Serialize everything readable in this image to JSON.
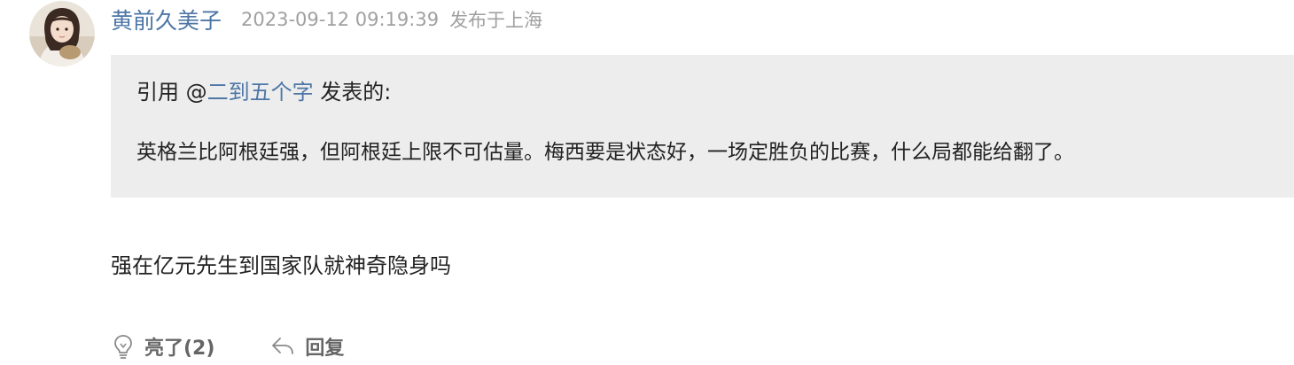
{
  "comment": {
    "author": "黄前久美子",
    "timestamp": "2023-09-12 09:19:39",
    "location": "发布于上海",
    "avatar_icon": "user-avatar-photo",
    "quote": {
      "prefix": "引用 @",
      "user": "二到五个字",
      "suffix": " 发表的:",
      "text": "英格兰比阿根廷强，但阿根廷上限不可估量。梅西要是状态好，一场定胜负的比赛，什么局都能给翻了。"
    },
    "text": "强在亿元先生到国家队就神奇隐身吗",
    "actions": {
      "like_label": "亮了(2)",
      "like_icon": "lightbulb-icon",
      "reply_label": "回复",
      "reply_icon": "reply-arrow-icon"
    }
  },
  "colors": {
    "link": "#4d76a6",
    "meta": "#a0a0a0",
    "quote_bg": "#ededed",
    "text": "#222222",
    "action": "#666666"
  }
}
